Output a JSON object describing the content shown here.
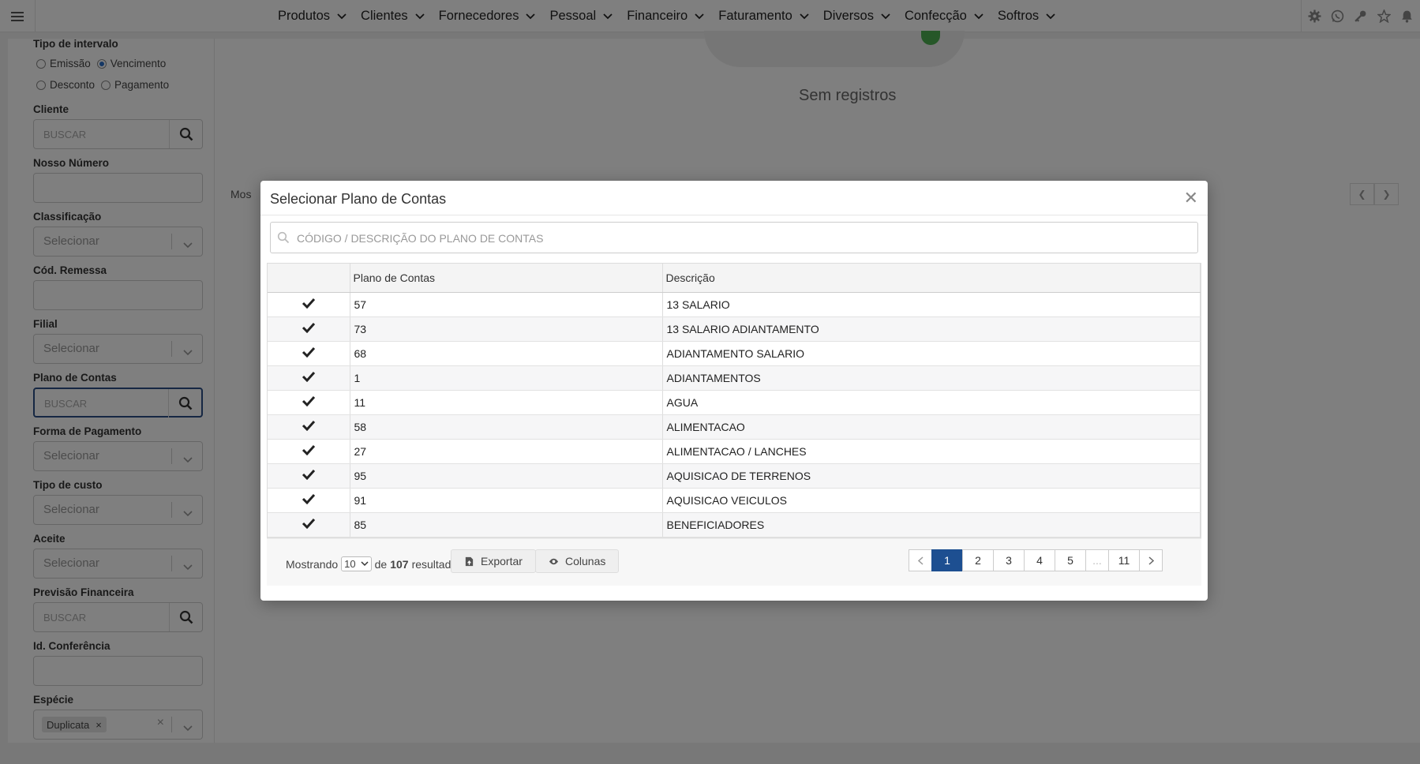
{
  "navbar": {
    "menu": [
      "Produtos",
      "Clientes",
      "Fornecedores",
      "Pessoal",
      "Financeiro",
      "Faturamento",
      "Diversos",
      "Confecção",
      "Softros"
    ],
    "right_icons": [
      "gear-icon",
      "whatsapp-icon",
      "key-icon",
      "star-icon",
      "bell-icon"
    ]
  },
  "filters": {
    "interval_label": "Tipo de intervalo",
    "interval_options": [
      "Emissão",
      "Vencimento",
      "Desconto",
      "Pagamento"
    ],
    "interval_selected": "Vencimento",
    "cliente_label": "Cliente",
    "cliente_placeholder": "BUSCAR",
    "nosso_numero_label": "Nosso Número",
    "classificacao_label": "Classificação",
    "classificacao_value": "Selecionar",
    "cod_remessa_label": "Cód. Remessa",
    "filial_label": "Filial",
    "filial_value": "Selecionar",
    "plano_label": "Plano de Contas",
    "plano_placeholder": "BUSCAR",
    "forma_label": "Forma de Pagamento",
    "forma_value": "Selecionar",
    "tipo_custo_label": "Tipo de custo",
    "tipo_custo_value": "Selecionar",
    "aceite_label": "Aceite",
    "aceite_value": "Selecionar",
    "previsao_label": "Previsão Financeira",
    "previsao_placeholder": "BUSCAR",
    "conferencia_label": "Id. Conferência",
    "especie_label": "Espécie",
    "especie_tag": "Duplicata"
  },
  "background": {
    "empty_text": "Sem registros",
    "mostrando_partial": "Mos"
  },
  "modal": {
    "title": "Selecionar Plano de Contas",
    "search_placeholder": "CÓDIGO / DESCRIÇÃO DO PLANO DE CONTAS",
    "columns": [
      "",
      "Plano de Contas",
      "Descrição"
    ],
    "rows": [
      {
        "code": "57",
        "desc": "13 SALARIO"
      },
      {
        "code": "73",
        "desc": "13 SALARIO ADIANTAMENTO"
      },
      {
        "code": "68",
        "desc": "ADIANTAMENTO SALARIO"
      },
      {
        "code": "1",
        "desc": "ADIANTAMENTOS"
      },
      {
        "code": "11",
        "desc": "AGUA"
      },
      {
        "code": "58",
        "desc": "ALIMENTACAO"
      },
      {
        "code": "27",
        "desc": "ALIMENTACAO / LANCHES"
      },
      {
        "code": "95",
        "desc": "AQUISICAO DE TERRENOS"
      },
      {
        "code": "91",
        "desc": "AQUISICAO VEICULOS"
      },
      {
        "code": "85",
        "desc": "BENEFICIADORES"
      }
    ],
    "footer": {
      "mostrando": "Mostrando",
      "per_page": "10",
      "de": "de",
      "total": "107",
      "resultados": "resultados",
      "export_label": "Exportar",
      "columns_label": "Colunas",
      "pages": [
        "1",
        "2",
        "3",
        "4",
        "5",
        "...",
        "11"
      ],
      "current_page": "1"
    }
  },
  "colors": {
    "accent": "#1d4f91",
    "overlay": "#000000"
  }
}
